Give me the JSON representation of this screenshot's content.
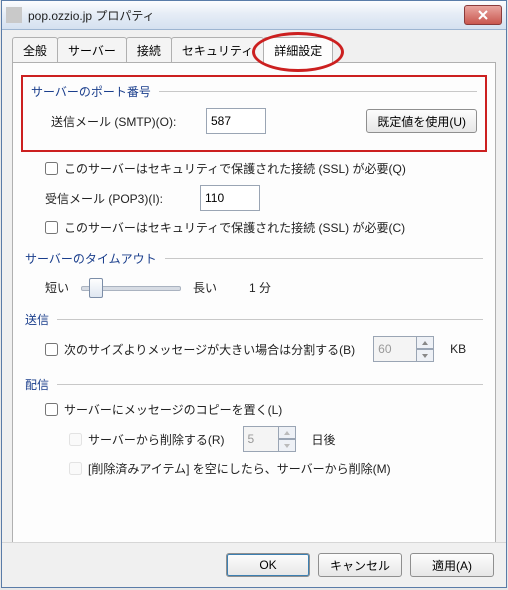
{
  "window": {
    "title": "pop.ozzio.jp プロパティ"
  },
  "tabs": {
    "items": [
      {
        "label": "全般"
      },
      {
        "label": "サーバー"
      },
      {
        "label": "接続"
      },
      {
        "label": "セキュリティ"
      },
      {
        "label": "詳細設定"
      }
    ],
    "active_index": 4
  },
  "groups": {
    "ports": {
      "title": "サーバーのポート番号",
      "smtp_label": "送信メール (SMTP)(O):",
      "smtp_value": "587",
      "default_btn": "既定値を使用(U)",
      "smtp_ssl": "このサーバーはセキュリティで保護された接続 (SSL) が必要(Q)",
      "pop_label": "受信メール (POP3)(I):",
      "pop_value": "110",
      "pop_ssl": "このサーバーはセキュリティで保護された接続 (SSL) が必要(C)"
    },
    "timeout": {
      "title": "サーバーのタイムアウト",
      "short": "短い",
      "long": "長い",
      "value_text": "1 分"
    },
    "send": {
      "title": "送信",
      "split_label": "次のサイズよりメッセージが大きい場合は分割する(B)",
      "split_value": "60",
      "unit": "KB"
    },
    "delivery": {
      "title": "配信",
      "leave_copy": "サーバーにメッセージのコピーを置く(L)",
      "remove_after_label": "サーバーから削除する(R)",
      "remove_after_value": "5",
      "days_suffix": "日後",
      "empty_deleted": "[削除済みアイテム] を空にしたら、サーバーから削除(M)"
    }
  },
  "footer": {
    "ok": "OK",
    "cancel": "キャンセル",
    "apply": "適用(A)"
  }
}
